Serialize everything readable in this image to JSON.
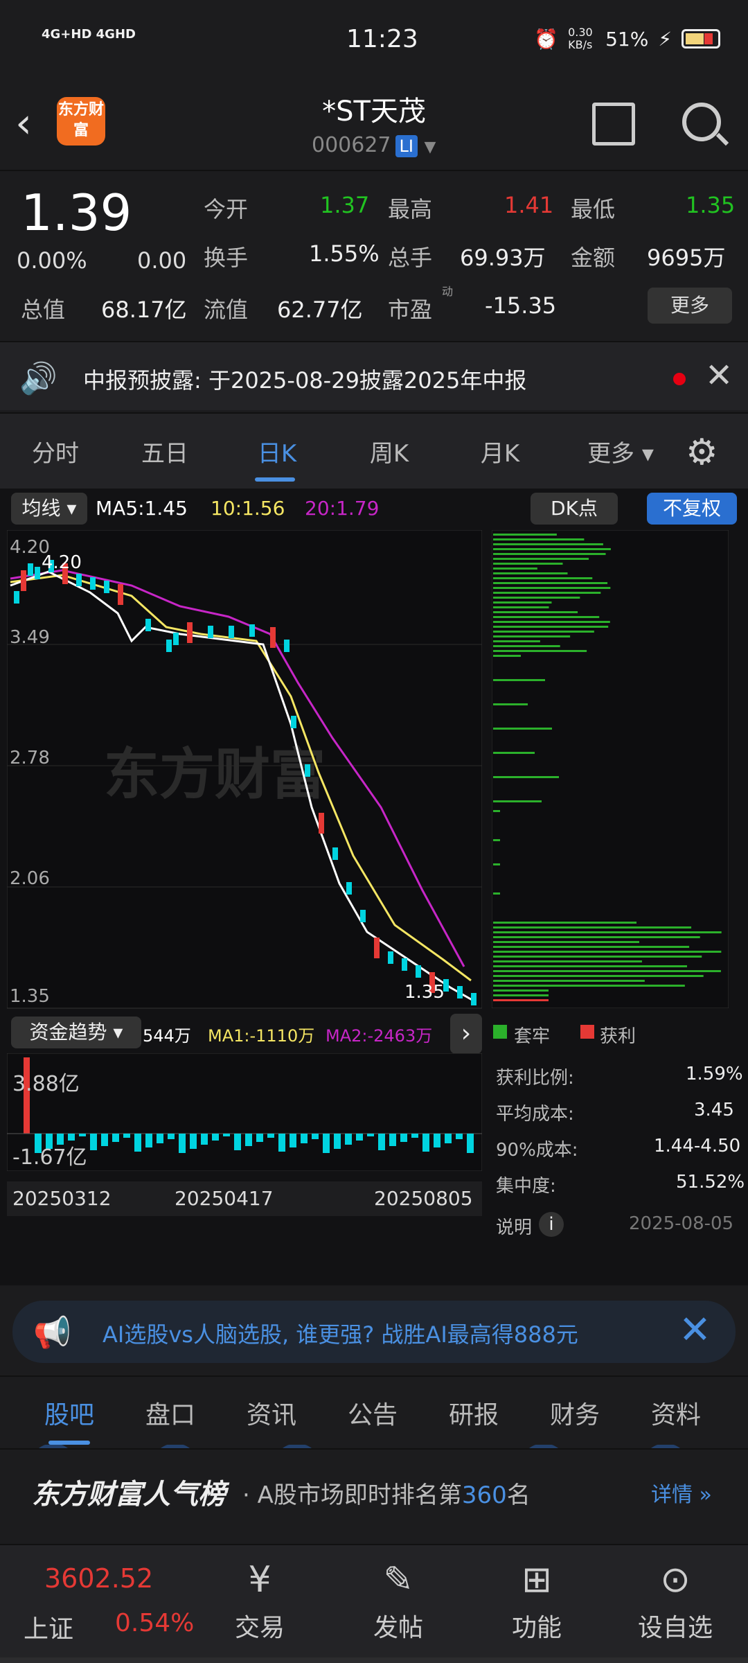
{
  "status": {
    "network": "4G+HD 4GHD",
    "time": "11:23",
    "speed": "0.30 KB/s",
    "battery": "51%"
  },
  "header": {
    "logo": "东方财富",
    "title": "*ST天茂",
    "code": "000627",
    "tag": "LI"
  },
  "quote": {
    "price": "1.39",
    "pct": "0.00%",
    "chg": "0.00",
    "open_label": "今开",
    "open": "1.37",
    "high_label": "最高",
    "high": "1.41",
    "low_label": "最低",
    "low": "1.35",
    "turnover_label": "换手",
    "turnover": "1.55%",
    "vol_label": "总手",
    "vol": "69.93万",
    "amt_label": "金额",
    "amt": "9695万",
    "mcap_label": "总值",
    "mcap": "68.17亿",
    "float_label": "流值",
    "float": "62.77亿",
    "pe_label": "市盈",
    "pe_sup": "动",
    "pe": "-15.35",
    "more": "更多"
  },
  "notice": {
    "text": "中报预披露: 于2025-08-29披露2025年中报"
  },
  "tabs": [
    "分时",
    "五日",
    "日K",
    "周K",
    "月K",
    "更多"
  ],
  "chart": {
    "ma_label": "均线",
    "ma5": "MA5:1.45",
    "ma10": "10:1.56",
    "ma20": "20:1.79",
    "dk": "DK点",
    "adj": "不复权",
    "y_labels": [
      "4.20",
      "3.49",
      "2.78",
      "2.06",
      "1.35"
    ],
    "high_mark": "4.20",
    "low_mark": "1.35",
    "fund_label": "资金趋势",
    "fund_v": "544万",
    "ma1": "MA1:-1110万",
    "ma2": "MA2:-2463万",
    "fund_high": "3.88亿",
    "fund_low": "-1.67亿",
    "dates": [
      "20250312",
      "20250417",
      "20250805"
    ],
    "colors": {
      "up": "#e53935",
      "down": "#00d4e0",
      "ma5": "#ffffff",
      "ma10": "#f5e663",
      "ma20": "#c726c7",
      "trapped": "#2bb02b",
      "profit": "#e53935"
    }
  },
  "chips": {
    "legend_trapped": "套牢",
    "legend_profit": "获利",
    "rows": [
      {
        "k": "获利比例:",
        "v": "1.59%"
      },
      {
        "k": "平均成本:",
        "v": "3.45"
      },
      {
        "k": "90%成本:",
        "v": "1.44-4.50"
      },
      {
        "k": "集中度:",
        "v": "51.52%"
      }
    ],
    "note": "说明",
    "date": "2025-08-05"
  },
  "ad": {
    "text": "AI选股vs人脑选股, 谁更强? 战胜AI最高得888元"
  },
  "subtabs": [
    "股吧",
    "盘口",
    "资讯",
    "公告",
    "研报",
    "财务",
    "资料"
  ],
  "rank": {
    "brand": "东方财富人气榜",
    "prefix": "· A股市场即时排名第",
    "num": "360",
    "suffix": "名",
    "detail": "详情"
  },
  "bottom": {
    "index_value": "3602.52",
    "index_name": "上证",
    "index_pct": "0.54%",
    "nav": [
      "交易",
      "发帖",
      "功能",
      "设自选"
    ]
  },
  "chart_data": {
    "type": "table",
    "candles_trend": "downtrend from ~4.20 to ~1.35",
    "chip_ratio": "1.59%"
  }
}
